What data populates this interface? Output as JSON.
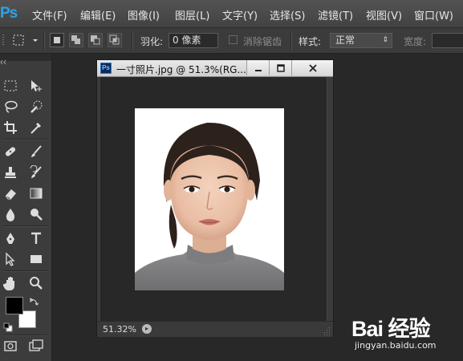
{
  "app": {
    "logo": "Ps",
    "menu": [
      {
        "label": "文件(F)"
      },
      {
        "label": "编辑(E)"
      },
      {
        "label": "图像(I)"
      },
      {
        "label": "图层(L)"
      },
      {
        "label": "文字(Y)"
      },
      {
        "label": "选择(S)"
      },
      {
        "label": "滤镜(T)"
      },
      {
        "label": "视图(V)"
      },
      {
        "label": "窗口(W)"
      }
    ]
  },
  "options_bar": {
    "feather_label": "羽化:",
    "feather_value": "0 像素",
    "antialias_label": "消除锯齿",
    "style_label": "样式:",
    "style_value": "正常",
    "width_label": "宽度:"
  },
  "toolbox": {
    "foreground_color": "#000000",
    "background_color": "#ffffff"
  },
  "document": {
    "icon_label": "Ps",
    "title": "一寸照片.jpg @ 51.3%(RG...",
    "zoom": "51.32%"
  },
  "watermark": {
    "logo": "Bai 经验",
    "url": "jingyan.baidu.com"
  },
  "colors": {
    "accent": "#2fa3e6",
    "workspace": "#282828",
    "panel": "#3c3c3c"
  }
}
